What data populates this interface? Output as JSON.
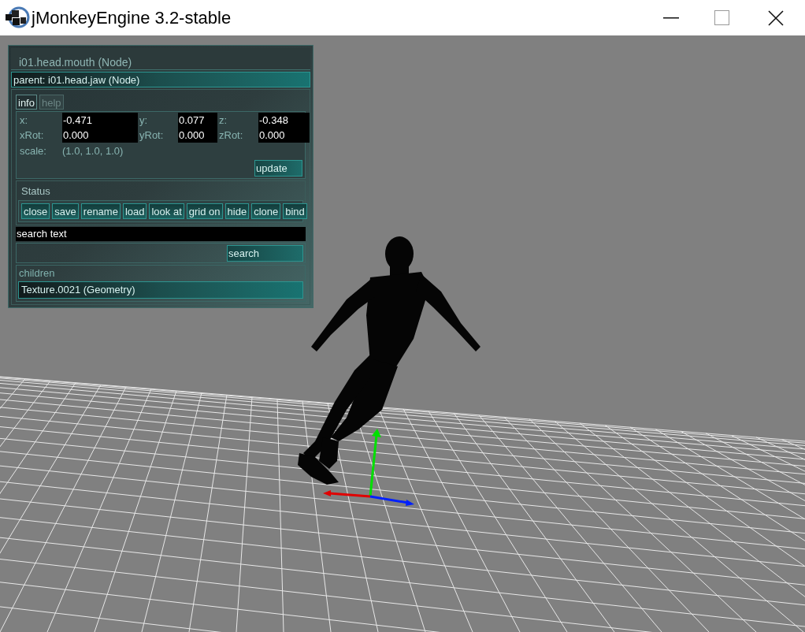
{
  "window": {
    "title": "jMonkeyEngine 3.2-stable"
  },
  "panel": {
    "title": "i01.head.mouth (Node)",
    "parent": "parent: i01.head.jaw (Node)",
    "tabs": [
      {
        "label": "info",
        "selected": true
      },
      {
        "label": "help",
        "selected": false
      }
    ],
    "fields": [
      {
        "label": "x:",
        "value": "-0.471"
      },
      {
        "label": "y:",
        "value": "0.077"
      },
      {
        "label": "z:",
        "value": "-0.348"
      },
      {
        "label": "xRot:",
        "value": "0.000"
      },
      {
        "label": "yRot:",
        "value": "0.000"
      },
      {
        "label": "zRot:",
        "value": "0.000"
      }
    ],
    "scale": {
      "label": "scale:",
      "value": "(1.0, 1.0, 1.0)"
    },
    "update_button": "update",
    "status_label": "Status",
    "buttons": [
      "close",
      "save",
      "rename",
      "load",
      "look at",
      "grid on",
      "hide",
      "clone",
      "bind"
    ],
    "search_field": {
      "value": "search text"
    },
    "search_button": "search",
    "children_label": "children",
    "children": [
      "Texture.0021 (Geometry)"
    ]
  }
}
